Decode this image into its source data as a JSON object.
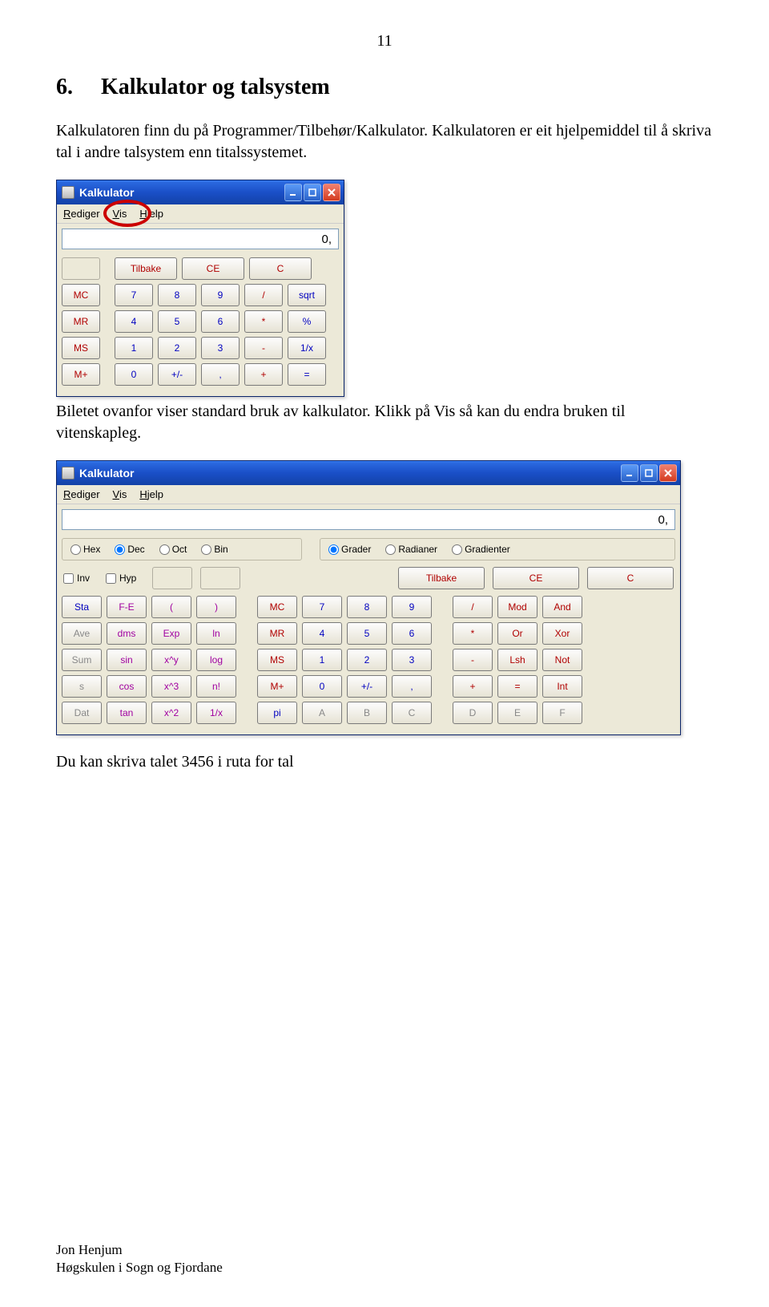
{
  "page_number": "11",
  "section_number": "6.",
  "section_title": "Kalkulator og talsystem",
  "para1": "Kalkulatoren finn du på Programmer/Tilbehør/Kalkulator. Kalkulatoren er eit hjelpemiddel til å skriva tal i andre talsystem enn titalssystemet.",
  "para2": "Biletet ovanfor viser standard bruk av kalkulator. Klikk på Vis  så kan du endra bruken til vitenskapleg.",
  "para3": "Du kan skriva talet 3456 i ruta for tal",
  "footer_line1": "Jon Henjum",
  "footer_line2": "Høgskulen i Sogn og Fjordane",
  "calcStd": {
    "title": "Kalkulator",
    "menu": {
      "rediger": "Rediger",
      "vis": "Vis",
      "hjelp": "Hjelp"
    },
    "display": "0,",
    "row_clear": {
      "tilbake": "Tilbake",
      "ce": "CE",
      "c": "C"
    },
    "rows": [
      {
        "m": "MC",
        "a": "7",
        "b": "8",
        "c": "9",
        "d": "/",
        "e": "sqrt"
      },
      {
        "m": "MR",
        "a": "4",
        "b": "5",
        "c": "6",
        "d": "*",
        "e": "%"
      },
      {
        "m": "MS",
        "a": "1",
        "b": "2",
        "c": "3",
        "d": "-",
        "e": "1/x"
      },
      {
        "m": "M+",
        "a": "0",
        "b": "+/-",
        "c": ",",
        "d": "+",
        "e": "="
      }
    ]
  },
  "calcSci": {
    "title": "Kalkulator",
    "menu": {
      "rediger": "Rediger",
      "vis": "Vis",
      "hjelp": "Hjelp"
    },
    "display": "0,",
    "bases": {
      "hex": "Hex",
      "dec": "Dec",
      "oct": "Oct",
      "bin": "Bin"
    },
    "angles": {
      "grader": "Grader",
      "radianer": "Radianer",
      "gradienter": "Gradienter"
    },
    "checks": {
      "inv": "Inv",
      "hyp": "Hyp"
    },
    "clear": {
      "tilbake": "Tilbake",
      "ce": "CE",
      "c": "C"
    },
    "rows": [
      [
        "Sta",
        "F-E",
        "(",
        ")",
        "MC",
        "7",
        "8",
        "9",
        "/",
        "Mod",
        "And"
      ],
      [
        "Ave",
        "dms",
        "Exp",
        "ln",
        "MR",
        "4",
        "5",
        "6",
        "*",
        "Or",
        "Xor"
      ],
      [
        "Sum",
        "sin",
        "x^y",
        "log",
        "MS",
        "1",
        "2",
        "3",
        "-",
        "Lsh",
        "Not"
      ],
      [
        "s",
        "cos",
        "x^3",
        "n!",
        "M+",
        "0",
        "+/-",
        ",",
        "+",
        "=",
        "Int"
      ],
      [
        "Dat",
        "tan",
        "x^2",
        "1/x",
        "pi",
        "A",
        "B",
        "C",
        "D",
        "E",
        "F"
      ]
    ],
    "rowClasses": [
      [
        "blue",
        "mag",
        "mag",
        "mag",
        "red",
        "blue",
        "blue",
        "blue",
        "red",
        "red",
        "red"
      ],
      [
        "gray",
        "mag",
        "mag",
        "mag",
        "red",
        "blue",
        "blue",
        "blue",
        "red",
        "red",
        "red"
      ],
      [
        "gray",
        "mag",
        "mag",
        "mag",
        "red",
        "blue",
        "blue",
        "blue",
        "red",
        "red",
        "red"
      ],
      [
        "gray",
        "mag",
        "mag",
        "mag",
        "red",
        "blue",
        "blue",
        "blue",
        "red",
        "red",
        "red"
      ],
      [
        "gray",
        "mag",
        "mag",
        "mag",
        "blue",
        "gray",
        "gray",
        "gray",
        "gray",
        "gray",
        "gray"
      ]
    ]
  }
}
